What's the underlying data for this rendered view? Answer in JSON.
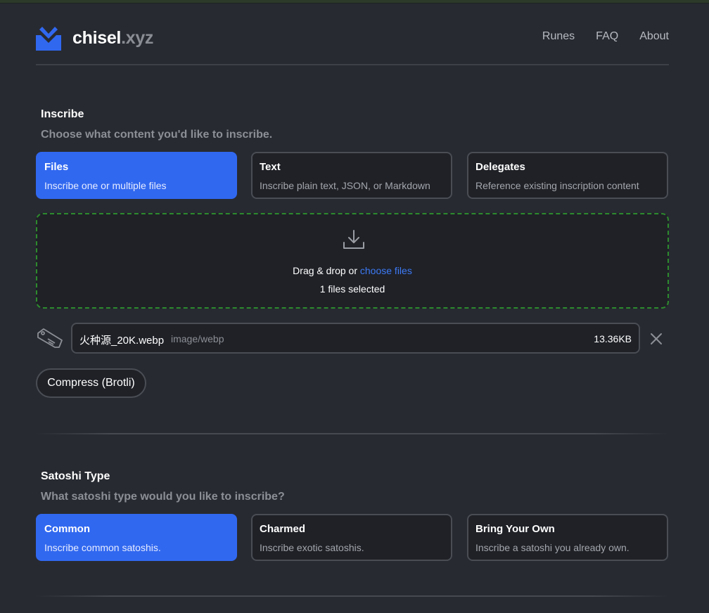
{
  "header": {
    "brand_main": "chisel",
    "brand_suffix": ".xyz",
    "nav": [
      "Runes",
      "FAQ",
      "About"
    ],
    "accent_color": "#3168f0"
  },
  "inscribe": {
    "title": "Inscribe",
    "subtitle": "Choose what content you'd like to inscribe.",
    "options": [
      {
        "title": "Files",
        "description": "Inscribe one or multiple files",
        "selected": true
      },
      {
        "title": "Text",
        "description": "Inscribe plain text, JSON, or Markdown",
        "selected": false
      },
      {
        "title": "Delegates",
        "description": "Reference existing inscription content",
        "selected": false
      }
    ],
    "dropzone": {
      "icon": "download-icon",
      "text_prefix": "Drag & drop or ",
      "link_text": "choose files",
      "status": "1 files selected",
      "border_color": "#2d8a2d"
    },
    "file": {
      "icon": "tag-icon",
      "name": "火种源_20K.webp",
      "type": "image/webp",
      "size": "13.36KB",
      "remove_icon": "close-icon"
    },
    "compress_label": "Compress (Brotli)"
  },
  "satoshi": {
    "title": "Satoshi Type",
    "subtitle": "What satoshi type would you like to inscribe?",
    "options": [
      {
        "title": "Common",
        "description": "Inscribe common satoshis.",
        "selected": true
      },
      {
        "title": "Charmed",
        "description": "Inscribe exotic satoshis.",
        "selected": false
      },
      {
        "title": "Bring Your Own",
        "description": "Inscribe a satoshi you already own.",
        "selected": false
      }
    ]
  }
}
